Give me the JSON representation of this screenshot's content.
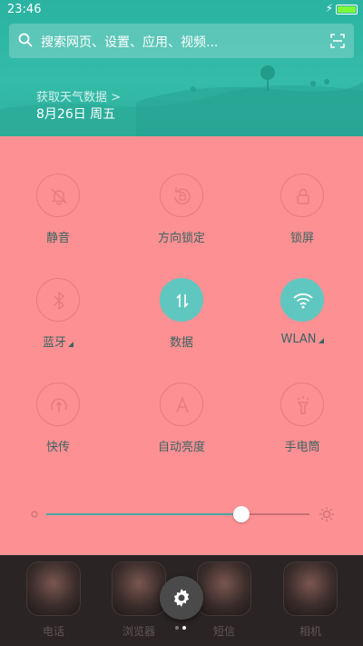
{
  "status_bar": {
    "time": "23:46",
    "charging_symbol": "⚡",
    "battery_level": 1.0
  },
  "search": {
    "placeholder": "搜索网页、设置、应用、视频..."
  },
  "weather": {
    "link": "获取天气数据 >",
    "date": "8月26日 周五"
  },
  "tiles": [
    {
      "label": "静音",
      "icon": "bell-muted-icon",
      "active": false
    },
    {
      "label": "方向锁定",
      "icon": "rotation-lock-icon",
      "active": false
    },
    {
      "label": "锁屏",
      "icon": "lock-icon",
      "active": false
    },
    {
      "label": "蓝牙",
      "icon": "bluetooth-icon",
      "active": false,
      "has_more": true
    },
    {
      "label": "数据",
      "icon": "mobile-data-icon",
      "active": true
    },
    {
      "label": "WLAN",
      "icon": "wifi-icon",
      "active": true,
      "has_more": true
    },
    {
      "label": "快传",
      "icon": "quick-transfer-icon",
      "active": false
    },
    {
      "label": "自动亮度",
      "icon": "auto-brightness-icon",
      "active": false
    },
    {
      "label": "手电筒",
      "icon": "flashlight-icon",
      "active": false
    }
  ],
  "brightness": {
    "level": 0.74
  },
  "dock": {
    "apps": [
      {
        "label": "电话"
      },
      {
        "label": "浏览器"
      },
      {
        "label": "短信"
      },
      {
        "label": "相机"
      }
    ],
    "page_count": 2,
    "current_page": 2
  },
  "colors": {
    "header": "#34bca9",
    "panel": "#fd9093",
    "active_tile": "#5fc7c0",
    "label": "#3b6461"
  }
}
